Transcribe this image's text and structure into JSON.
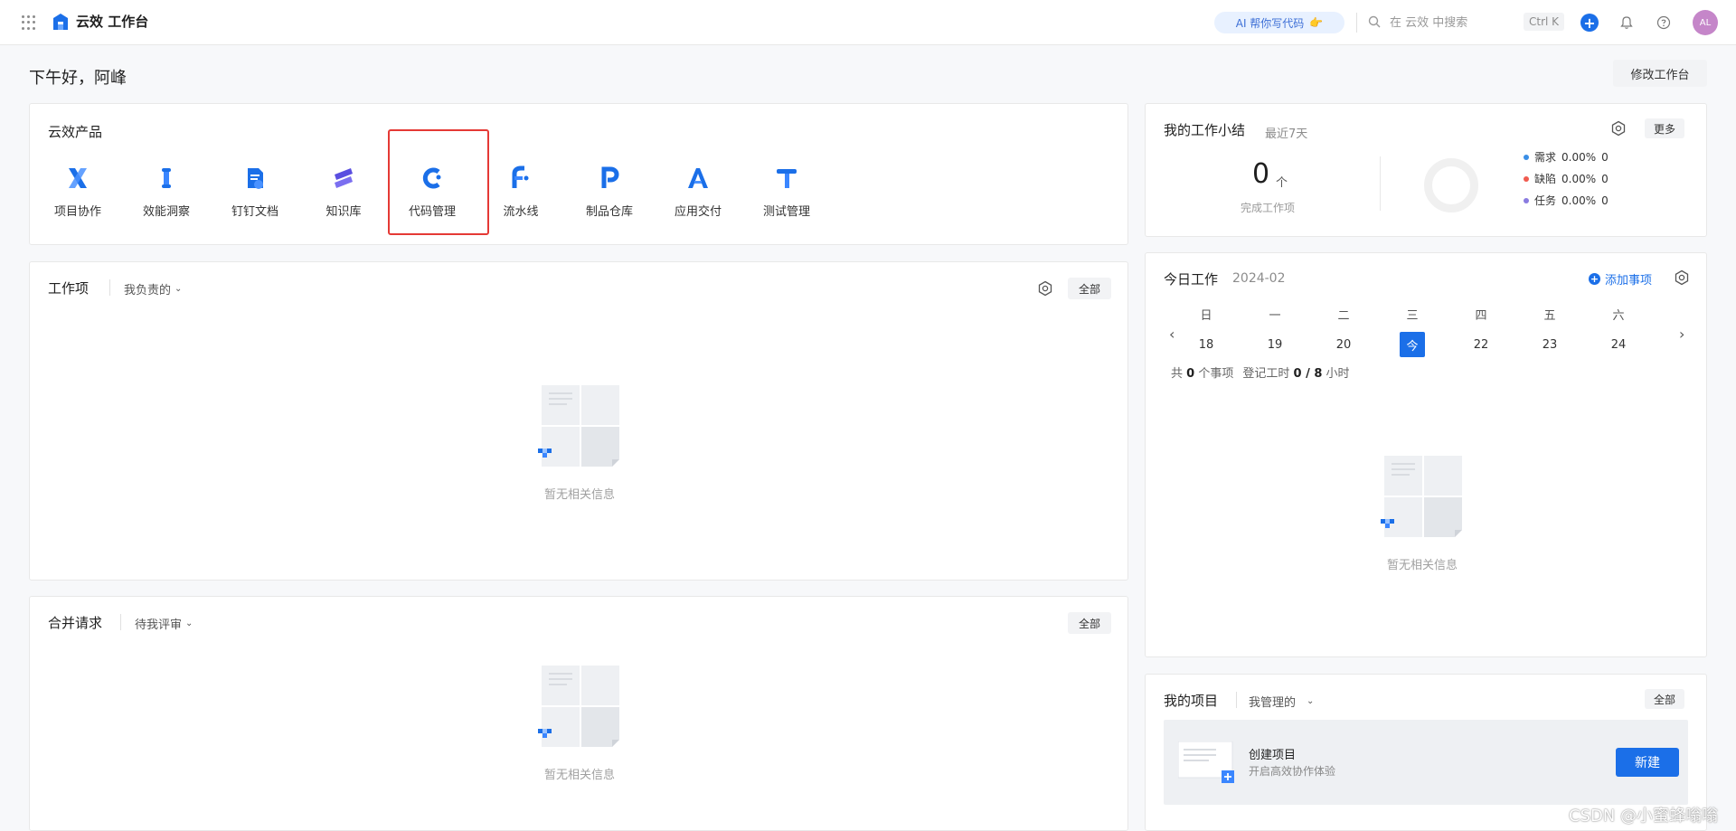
{
  "header": {
    "logo_text": "云效 工作台",
    "ai_pill": "AI 帮你写代码",
    "search_placeholder": "在 云效 中搜索",
    "shortcut": "Ctrl K",
    "avatar_initials": "AL"
  },
  "greeting": "下午好，阿峰",
  "edit_workbench": "修改工作台",
  "products": {
    "title": "云效产品",
    "items": [
      {
        "label": "项目协作",
        "icon": "x-icon",
        "color": "#1b6fe8"
      },
      {
        "label": "效能洞察",
        "icon": "i-icon",
        "color": "#1b6fe8"
      },
      {
        "label": "钉钉文档",
        "icon": "doc-icon",
        "color": "#1b6fe8"
      },
      {
        "label": "知识库",
        "icon": "s-icon",
        "color": "#5a4fe0"
      },
      {
        "label": "代码管理",
        "icon": "c-icon",
        "color": "#1b6fe8"
      },
      {
        "label": "流水线",
        "icon": "f-icon",
        "color": "#1b6fe8"
      },
      {
        "label": "制品仓库",
        "icon": "p-icon",
        "color": "#1b6fe8"
      },
      {
        "label": "应用交付",
        "icon": "a-icon",
        "color": "#1b6fe8"
      },
      {
        "label": "测试管理",
        "icon": "t-icon",
        "color": "#1b6fe8"
      }
    ]
  },
  "work_items": {
    "title": "工作项",
    "filter": "我负责的",
    "all": "全部",
    "empty": "暂无相关信息"
  },
  "merge_requests": {
    "title": "合并请求",
    "filter": "待我评审",
    "all": "全部",
    "empty": "暂无相关信息"
  },
  "summary": {
    "title": "我的工作小结",
    "period": "最近7天",
    "more": "更多",
    "count": "0",
    "unit": "个",
    "done_label": "完成工作项",
    "legend": [
      {
        "label": "需求",
        "value": "0.00%",
        "count": "0",
        "color": "#3a8ee6"
      },
      {
        "label": "缺陷",
        "value": "0.00%",
        "count": "0",
        "color": "#f05b4f"
      },
      {
        "label": "任务",
        "value": "0.00%",
        "count": "0",
        "color": "#8a7be0"
      }
    ]
  },
  "today": {
    "title": "今日工作",
    "month": "2024-02",
    "add": "添加事项",
    "days": [
      "日",
      "一",
      "二",
      "三",
      "四",
      "五",
      "六"
    ],
    "dates": [
      "18",
      "19",
      "20",
      "今",
      "22",
      "23",
      "24"
    ],
    "today_index": 3,
    "stats_prefix": "共",
    "stats_count": "0",
    "stats_suffix": "个事项",
    "hours_prefix": "登记工时",
    "hours_value": "0 / 8",
    "hours_suffix": "小时",
    "empty": "暂无相关信息"
  },
  "projects": {
    "title": "我的项目",
    "filter": "我管理的",
    "all": "全部",
    "create_title": "创建项目",
    "create_sub": "开启高效协作体验",
    "new": "新建"
  },
  "watermark": "CSDN @小蜜蜂嗡嗡"
}
